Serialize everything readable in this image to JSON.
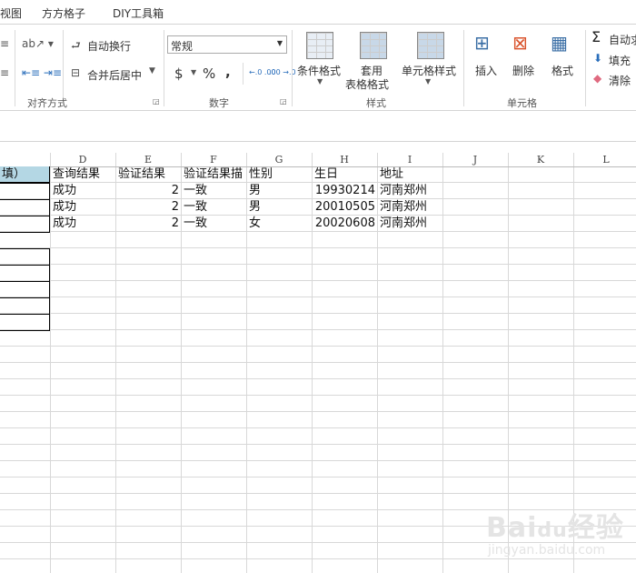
{
  "tabs": [
    "视图",
    "方方格子",
    "DIY工具箱"
  ],
  "ribbon": {
    "alignment": {
      "wrap_text": "自动换行",
      "merge_center": "合并后居中",
      "group": "对齐方式"
    },
    "number": {
      "format": "常规",
      "currency": "$",
      "percent": "%",
      "comma": ",",
      "inc_decimal": "←.0 .00",
      "dec_decimal": ".00 →.0",
      "group": "数字"
    },
    "styles": {
      "conditional": "条件格式",
      "table_format_1": "套用",
      "table_format_2": "表格格式",
      "cell_styles": "单元格样式",
      "group": "样式"
    },
    "cells": {
      "insert": "插入",
      "delete": "删除",
      "format": "格式",
      "group": "单元格"
    },
    "editing": {
      "autosum": "自动求",
      "fill": "填充",
      "clear": "清除"
    }
  },
  "sheet": {
    "columns": [
      "D",
      "E",
      "F",
      "G",
      "H",
      "I",
      "J",
      "K",
      "L"
    ],
    "header_partial": "填）",
    "rows": [
      [
        "查询结果",
        "验证结果",
        "验证结果描",
        "性别",
        "生日",
        "地址"
      ],
      [
        "成功",
        "2",
        "一致",
        "男",
        "19930214",
        "河南郑州"
      ],
      [
        "成功",
        "2",
        "一致",
        "男",
        "20010505",
        "河南郑州"
      ],
      [
        "成功",
        "2",
        "一致",
        "女",
        "20020608",
        "河南郑州"
      ]
    ],
    "header_fill": "#b4d7e4"
  },
  "watermark": {
    "brand": "Baidu经验",
    "url": "jingyan.baidu.com"
  }
}
